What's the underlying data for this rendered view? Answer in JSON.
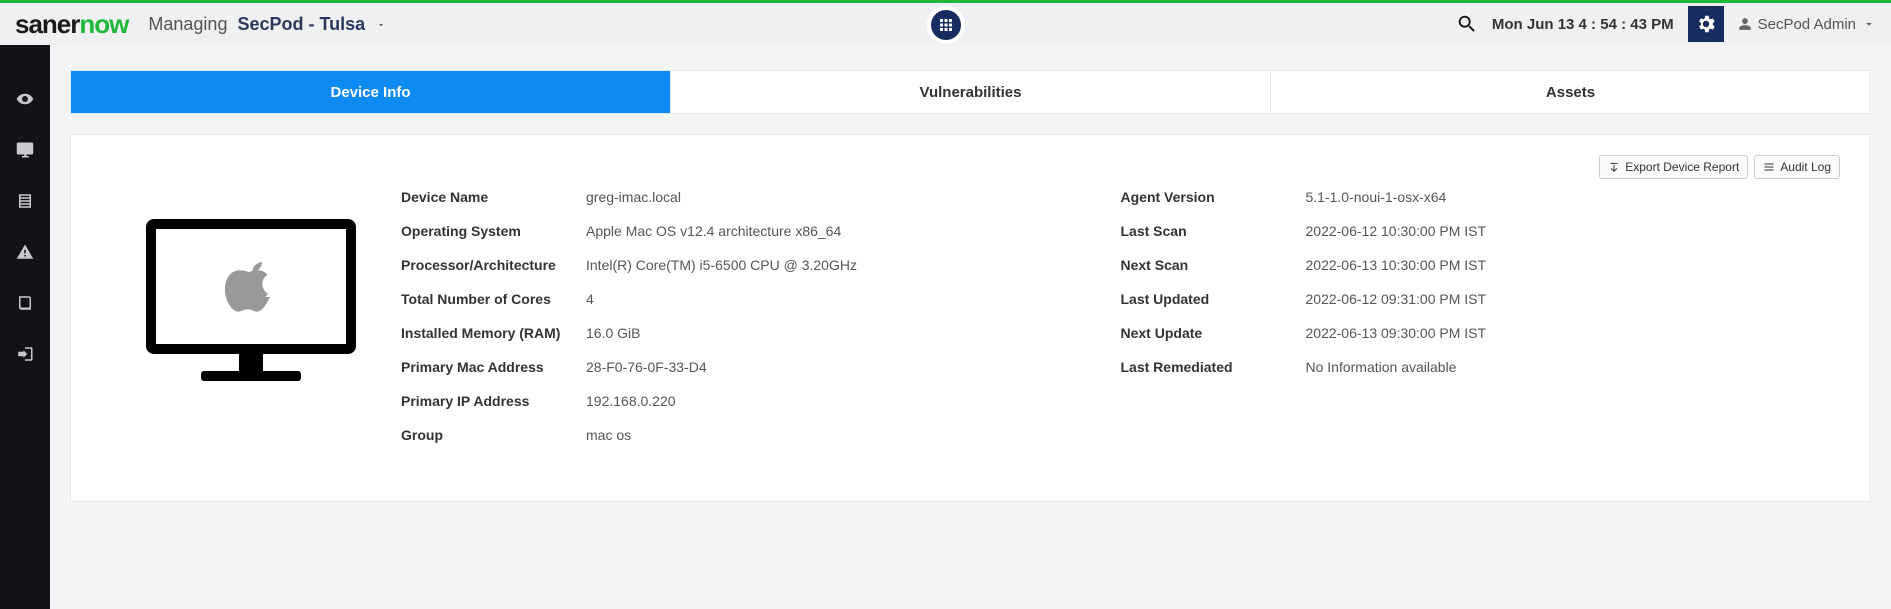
{
  "header": {
    "managing_label": "Managing",
    "org": "SecPod - Tulsa",
    "clock": "Mon Jun 13  4 : 54 : 43 PM",
    "user": "SecPod Admin"
  },
  "tabs": {
    "device_info": "Device Info",
    "vulnerabilities": "Vulnerabilities",
    "assets": "Assets"
  },
  "actions": {
    "export": "Export Device Report",
    "audit": "Audit Log"
  },
  "left": {
    "device_name": {
      "lbl": "Device Name",
      "val": "greg-imac.local"
    },
    "os": {
      "lbl": "Operating System",
      "val": "Apple Mac OS v12.4 architecture x86_64"
    },
    "proc": {
      "lbl": "Processor/Architecture",
      "val": "Intel(R) Core(TM) i5-6500 CPU @ 3.20GHz"
    },
    "cores": {
      "lbl": "Total Number of Cores",
      "val": "4"
    },
    "ram": {
      "lbl": "Installed Memory (RAM)",
      "val": "16.0 GiB"
    },
    "mac": {
      "lbl": "Primary Mac Address",
      "val": "28-F0-76-0F-33-D4"
    },
    "ip": {
      "lbl": "Primary IP Address",
      "val": "192.168.0.220"
    },
    "group": {
      "lbl": "Group",
      "val": "mac os"
    }
  },
  "right": {
    "agent": {
      "lbl": "Agent Version",
      "val": "5.1-1.0-noui-1-osx-x64"
    },
    "last_scan": {
      "lbl": "Last Scan",
      "val": "2022-06-12 10:30:00 PM IST"
    },
    "next_scan": {
      "lbl": "Next Scan",
      "val": "2022-06-13 10:30:00 PM IST"
    },
    "last_upd": {
      "lbl": "Last Updated",
      "val": "2022-06-12 09:31:00 PM IST"
    },
    "next_upd": {
      "lbl": "Next Update",
      "val": "2022-06-13 09:30:00 PM IST"
    },
    "last_rem": {
      "lbl": "Last Remediated",
      "val": "No Information available"
    }
  }
}
